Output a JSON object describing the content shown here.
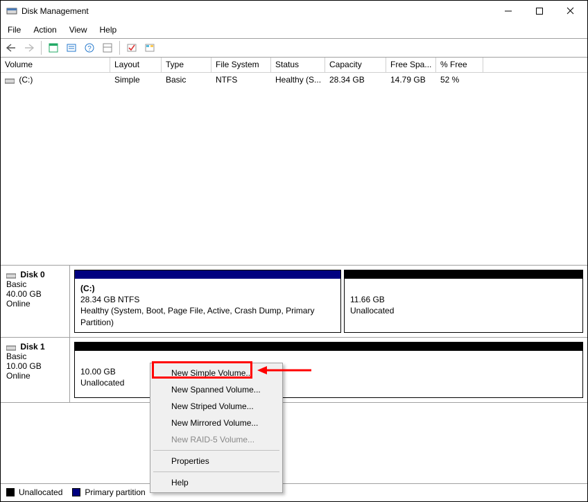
{
  "window": {
    "title": "Disk Management"
  },
  "menus": {
    "file": "File",
    "action": "Action",
    "view": "View",
    "help": "Help"
  },
  "headers": {
    "volume": "Volume",
    "layout": "Layout",
    "type": "Type",
    "fs": "File System",
    "status": "Status",
    "capacity": "Capacity",
    "free": "Free Spa...",
    "pfree": "% Free"
  },
  "row0": {
    "volume": "(C:)",
    "layout": "Simple",
    "type": "Basic",
    "fs": "NTFS",
    "status": "Healthy (S...",
    "capacity": "28.34 GB",
    "free": "14.79 GB",
    "pfree": "52 %"
  },
  "disk0": {
    "name": "Disk 0",
    "type": "Basic",
    "size": "40.00 GB",
    "state": "Online",
    "p0": {
      "label": "(C:)",
      "line1": "28.34 GB NTFS",
      "line2": "Healthy (System, Boot, Page File, Active, Crash Dump, Primary Partition)"
    },
    "p1": {
      "line1": "11.66 GB",
      "line2": "Unallocated"
    }
  },
  "disk1": {
    "name": "Disk 1",
    "type": "Basic",
    "size": "10.00 GB",
    "state": "Online",
    "p0": {
      "line1": "10.00 GB",
      "line2": "Unallocated"
    }
  },
  "ctx": {
    "simple": "New Simple Volume...",
    "spanned": "New Spanned Volume...",
    "striped": "New Striped Volume...",
    "mirrored": "New Mirrored Volume...",
    "raid": "New RAID-5 Volume...",
    "props": "Properties",
    "help": "Help"
  },
  "legend": {
    "unalloc": "Unallocated",
    "primary": "Primary partition"
  },
  "colors": {
    "primary": "#000080",
    "unalloc": "#000000"
  }
}
